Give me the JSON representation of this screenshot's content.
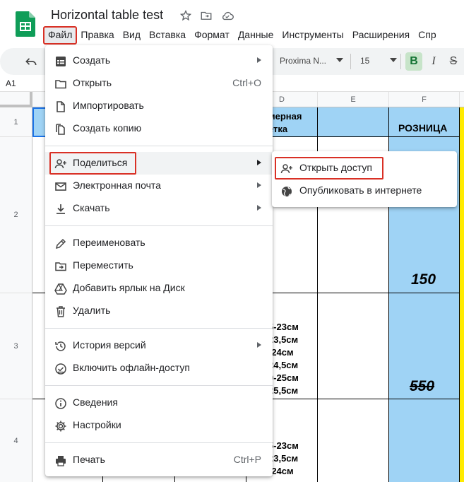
{
  "window": {
    "doc_title": "Horizontal table test"
  },
  "menubar": {
    "items": [
      "Файл",
      "Правка",
      "Вид",
      "Вставка",
      "Формат",
      "Данные",
      "Инструменты",
      "Расширения",
      "Спр"
    ],
    "active": "Файл"
  },
  "toolbar": {
    "font_name": "Proxima N...",
    "font_size": "15",
    "bold": "B",
    "italic": "I",
    "strike": "S"
  },
  "formula_bar": {
    "cell_ref": "A1"
  },
  "grid": {
    "columns": [
      "D",
      "E",
      "F"
    ],
    "rows": [
      "1",
      "2",
      "3",
      "4"
    ],
    "d1_line1": "мерная",
    "d1_line2": "етка",
    "f1": "РОЗНИЦА",
    "f2_price": "150",
    "f3_price": "550",
    "d3_lines": [
      "5-23см",
      "23,5см",
      "-24см",
      "24,5см",
      "0-25см",
      "25,5см"
    ],
    "d4_lines": [
      "5-23см",
      "23,5см",
      "-24см"
    ]
  },
  "file_menu": {
    "create": "Создать",
    "open": "Открыть",
    "open_shortcut": "Ctrl+O",
    "import": "Импортировать",
    "copy": "Создать копию",
    "share": "Поделиться",
    "email": "Электронная почта",
    "download": "Скачать",
    "rename": "Переименовать",
    "move": "Переместить",
    "shortcut": "Добавить ярлык на Диск",
    "delete": "Удалить",
    "versions": "История версий",
    "offline": "Включить офлайн-доступ",
    "details": "Сведения",
    "settings": "Настройки",
    "print": "Печать",
    "print_shortcut": "Ctrl+P"
  },
  "share_submenu": {
    "share_access": "Открыть доступ",
    "publish": "Опубликовать в интернете"
  },
  "colors": {
    "highlight_red": "#d93025",
    "cell_blue": "#9fd3f5",
    "accent_yellow": "#ffeb00",
    "sheets_green": "#0f9d58"
  }
}
